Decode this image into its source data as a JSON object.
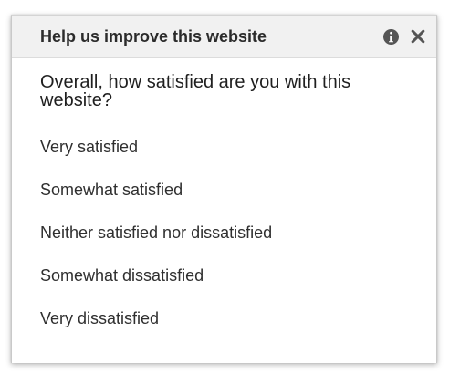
{
  "survey": {
    "title": "Help us improve this website",
    "icons": {
      "info": "info-icon",
      "close": "close-icon"
    },
    "question": "Overall, how satisfied are you with this website?",
    "options": [
      "Very satisfied",
      "Somewhat satisfied",
      "Neither satisfied nor dissatisfied",
      "Somewhat dissatisfied",
      "Very dissatisfied"
    ]
  },
  "colors": {
    "header_bg": "#f1f1f1",
    "icon_color": "#555555",
    "text_color": "#2f2f2f"
  }
}
